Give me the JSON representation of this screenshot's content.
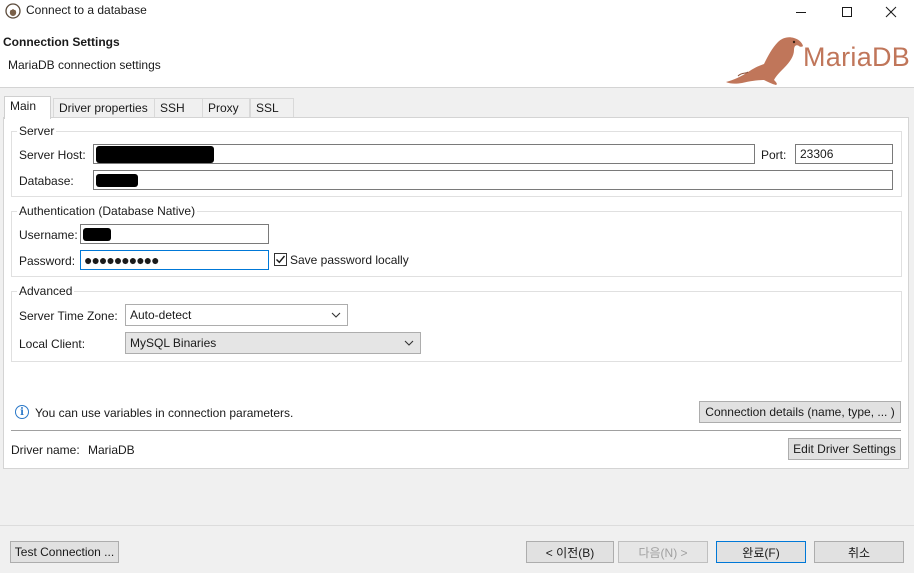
{
  "window": {
    "title": "Connect to a database",
    "icon": "dbeaver-icon"
  },
  "header": {
    "title": "Connection Settings",
    "subtitle": "MariaDB connection settings",
    "logo_text": "MariaDB"
  },
  "tabs": [
    {
      "label": "Main",
      "active": true
    },
    {
      "label": "Driver properties",
      "active": false
    },
    {
      "label": "SSH",
      "active": false
    },
    {
      "label": "Proxy",
      "active": false
    },
    {
      "label": "SSL",
      "active": false
    }
  ],
  "server": {
    "group_label": "Server",
    "host_label": "Server Host:",
    "port_label": "Port:",
    "port_value": "23306",
    "database_label": "Database:"
  },
  "auth": {
    "group_label": "Authentication (Database Native)",
    "username_label": "Username:",
    "password_label": "Password:",
    "password_mask": "●●●●●●●●●●",
    "save_password_label": "Save password locally",
    "save_password_checked": true
  },
  "advanced": {
    "group_label": "Advanced",
    "timezone_label": "Server Time Zone:",
    "timezone_value": "Auto-detect",
    "local_client_label": "Local Client:",
    "local_client_value": "MySQL Binaries"
  },
  "info": {
    "variables_note": "You can use variables in connection parameters.",
    "connection_details_button": "Connection details (name, type, ... )"
  },
  "driver": {
    "name_label": "Driver name:",
    "name_value": "MariaDB",
    "edit_button": "Edit Driver Settings"
  },
  "footer": {
    "test_connection": "Test Connection ...",
    "back": "< 이전(B)",
    "next": "다음(N) >",
    "finish": "완료(F)",
    "cancel": "취소"
  },
  "colors": {
    "accent": "#0078d7",
    "logo": "#c0765a"
  }
}
